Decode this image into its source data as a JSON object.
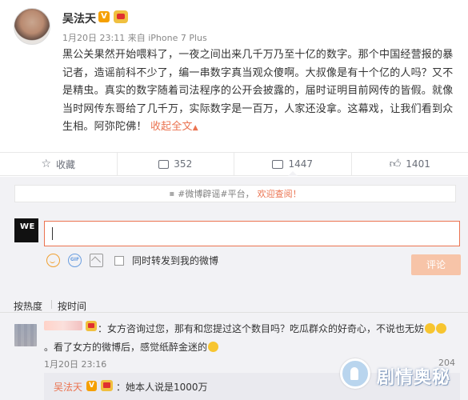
{
  "post": {
    "author_name": "吴法天",
    "verified_badge": "V",
    "timestamp": "1月20日 23:11",
    "source_prefix": "来自",
    "source_device": "iPhone 7 Plus",
    "content": "黑公关果然开始喂料了，一夜之间出来几千万乃至十亿的数字。那个中国经营报的暴记者，造谣前科不少了，编一串数字真当观众傻啊。大叔像是有十个亿的人吗？又不是精虫。真实的数字随着司法程序的公开会披露的，届时证明目前网传的皆假。就像当时网传东哥给了几千万，实际数字是一百万，人家还没拿。这幕戏，让我们看到众生相。阿弥陀佛！",
    "collapse_link": "收起全文",
    "collapse_icon": "up-arrow-icon"
  },
  "actions": {
    "favorite_label": "收藏",
    "favorite_icon": "star-icon",
    "share_count": "352",
    "share_icon": "share-icon",
    "comment_count": "1447",
    "comment_icon": "comment-icon",
    "like_count": "1401",
    "like_icon": "thumbs-up-icon"
  },
  "rumor_bar": {
    "prefix": "#微博辟谣#平台，",
    "link": "欢迎查阅！"
  },
  "comment_box": {
    "my_avatar_text_top": "WE",
    "placeholder": "",
    "sync_label": "同时转发到我的微博",
    "submit_label": "评论"
  },
  "sort": {
    "hot": "按热度",
    "time": "按时间"
  },
  "comments": [
    {
      "text_line1": "：女方咨询过您，那有和您提过这个数目吗？吃瓜群众的好奇心，不说也无妨",
      "text_line2": "。看了女方的微博后，感觉纸醉金迷的",
      "timestamp": "1月20日 23:16",
      "like_count": "204",
      "reply": {
        "author": "吴法天",
        "verified_badge": "V",
        "text": "：她本人说是1000万"
      }
    }
  ],
  "watermark": {
    "text": "剧情奥秘"
  },
  "colors": {
    "accent": "#eb7350",
    "verified": "#f5a000",
    "submit_disabled": "#f7c4a8",
    "comment_bg": "#f2f2f5"
  }
}
